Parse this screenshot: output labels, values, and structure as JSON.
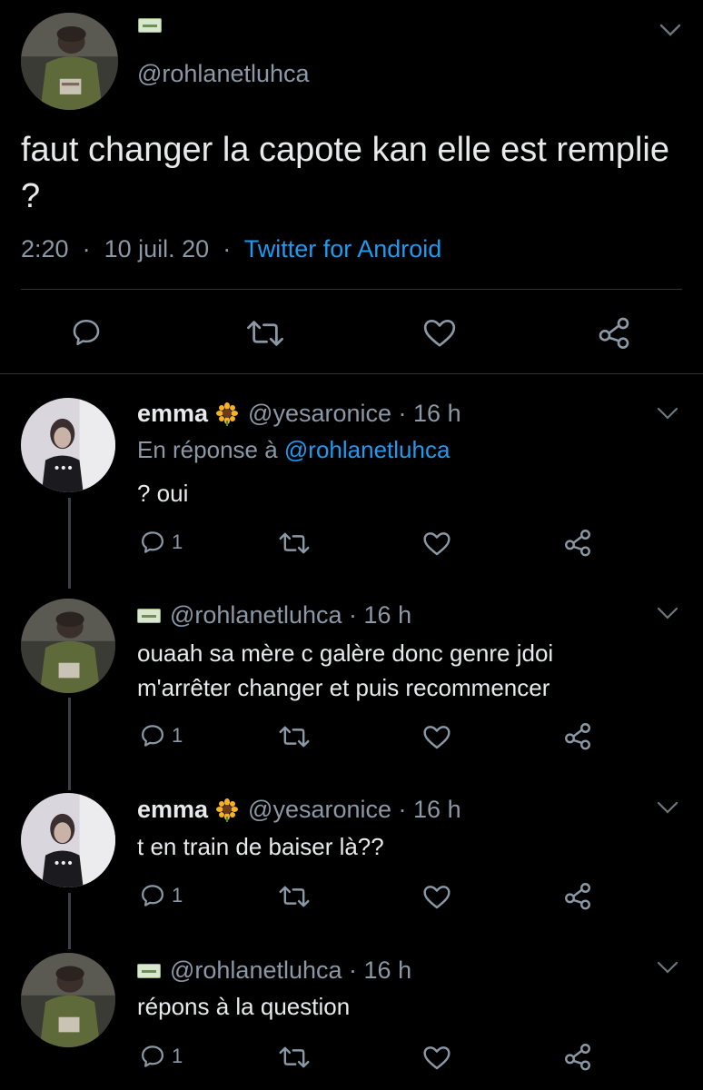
{
  "main_tweet": {
    "handle": "@rohlanetluhca",
    "text": "faut changer la capote kan elle est remplie ?",
    "time": "2:20",
    "date": "10 juil. 20",
    "source": "Twitter for Android"
  },
  "replies": [
    {
      "name": "emma",
      "name_emoji": "sunflower-icon",
      "handle": "@yesaronice",
      "time": "16 h",
      "reply_prefix": "En réponse à",
      "reply_to": "@rohlanetluhca",
      "text": "? oui",
      "reply_count": "1"
    },
    {
      "handle": "@rohlanetluhca",
      "time": "16 h",
      "text": "ouaah sa mère c galère donc genre jdoi m'arrêter changer et puis recommencer",
      "reply_count": "1"
    },
    {
      "name": "emma",
      "name_emoji": "sunflower-icon",
      "handle": "@yesaronice",
      "time": "16 h",
      "text": "t en train de baiser là??",
      "reply_count": "1"
    },
    {
      "handle": "@rohlanetluhca",
      "time": "16 h",
      "text": "répons à la question",
      "reply_count": "1"
    }
  ],
  "colors": {
    "background": "#000000",
    "text": "#e7e9ea",
    "secondary": "#8b98a5",
    "link": "#1d9bf0",
    "divider": "#2f3336"
  }
}
